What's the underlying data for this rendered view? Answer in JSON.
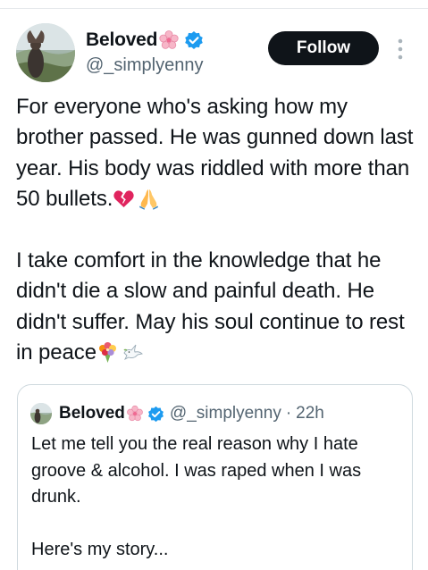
{
  "author": {
    "display_name": "Beloved",
    "handle": "@_simplyenny",
    "avatar_icon": "avatar-photo",
    "name_emoji_icon": "cherry-blossom-icon",
    "verified_icon": "verified-badge-icon"
  },
  "actions": {
    "follow_label": "Follow",
    "more_icon": "more-vertical-icon"
  },
  "tweet": {
    "line1": "For everyone who's asking how my brother passed. He was gunned down last year. His body was riddled with more than 50 bullets.",
    "line1_emojis": [
      "broken-heart-icon",
      "folded-hands-icon"
    ],
    "line2": "I take comfort in the knowledge that he didn't die a slow and painful death. He didn't suffer. May his soul continue to rest in peace",
    "line2_emojis": [
      "bouquet-icon",
      "dove-icon"
    ]
  },
  "quoted_tweet": {
    "display_name": "Beloved",
    "handle": "@_simplyenny",
    "separator": "·",
    "time": "22h",
    "para1": "Let me tell you the real reason why I hate groove & alcohol. I was raped when I was drunk.",
    "para2": "Here's my story..."
  },
  "colors": {
    "text_primary": "#0f1419",
    "text_secondary": "#536471",
    "verified_blue": "#1d9bf0",
    "follow_bg": "#0f1419",
    "border": "#cfd9de"
  }
}
